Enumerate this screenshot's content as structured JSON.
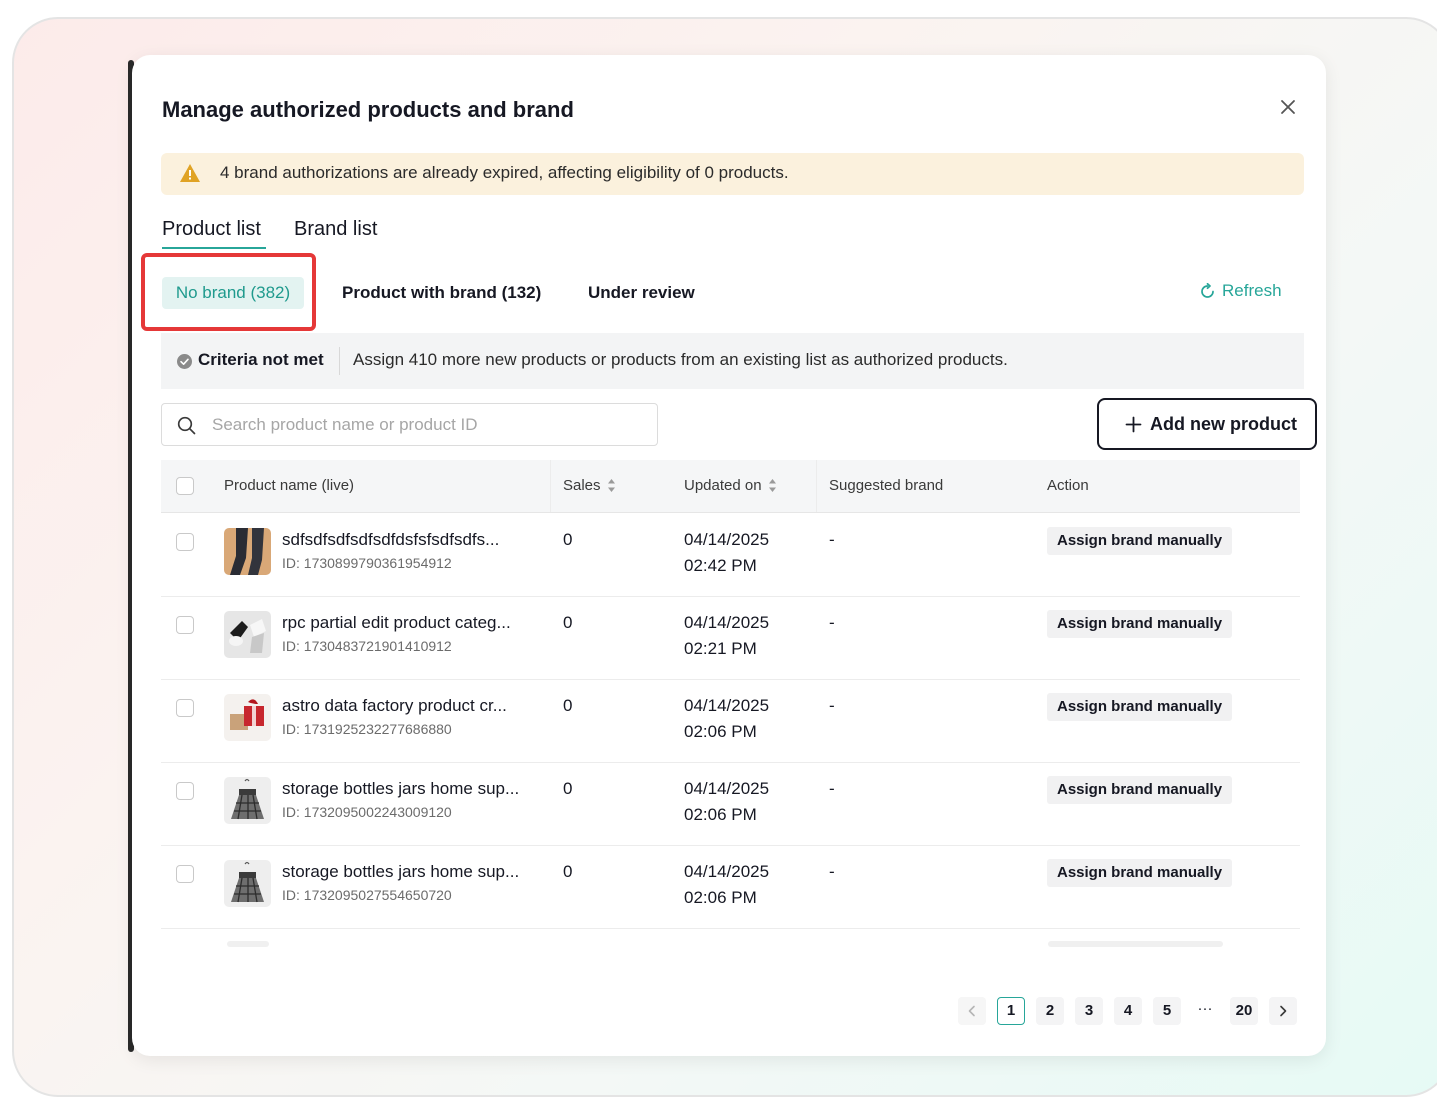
{
  "modal": {
    "title": "Manage authorized products and brand"
  },
  "alert": {
    "message": "4 brand authorizations are already expired, affecting eligibility of 0 products."
  },
  "tabs": [
    {
      "label": "Product list",
      "active": true
    },
    {
      "label": "Brand list",
      "active": false
    }
  ],
  "subtabs": [
    {
      "label": "No brand (382)",
      "active": true
    },
    {
      "label": "Product with brand (132)",
      "active": false
    },
    {
      "label": "Under review",
      "active": false
    }
  ],
  "refresh_label": "Refresh",
  "criteria": {
    "label": "Criteria not met",
    "description": "Assign 410 more new products or products from an existing list as authorized products."
  },
  "search": {
    "placeholder": "Search product name or product ID",
    "value": ""
  },
  "add_button_label": "Add new product",
  "table": {
    "columns": [
      "Product name (live)",
      "Sales",
      "Updated on",
      "Suggested brand",
      "Action"
    ],
    "rows": [
      {
        "name": "sdfsdfsdfsdfsdfdsfsfsdfsdfs...",
        "id": "ID: 1730899790361954912",
        "sales": "0",
        "date": "04/14/2025",
        "time": "02:42 PM",
        "brand": "-",
        "action": "Assign brand manually",
        "thumb": "stockings"
      },
      {
        "name": "rpc partial edit product categ...",
        "id": "ID: 1730483721901410912",
        "sales": "0",
        "date": "04/14/2025",
        "time": "02:21 PM",
        "brand": "-",
        "action": "Assign brand manually",
        "thumb": "socks"
      },
      {
        "name": "astro data factory product cr...",
        "id": "ID: 1731925232277686880",
        "sales": "0",
        "date": "04/14/2025",
        "time": "02:06 PM",
        "brand": "-",
        "action": "Assign brand manually",
        "thumb": "gift"
      },
      {
        "name": "storage bottles jars home sup...",
        "id": "ID: 1732095002243009120",
        "sales": "0",
        "date": "04/14/2025",
        "time": "02:06 PM",
        "brand": "-",
        "action": "Assign brand manually",
        "thumb": "skirt"
      },
      {
        "name": "storage bottles jars home sup...",
        "id": "ID: 1732095027554650720",
        "sales": "0",
        "date": "04/14/2025",
        "time": "02:06 PM",
        "brand": "-",
        "action": "Assign brand manually",
        "thumb": "skirt"
      }
    ]
  },
  "pagination": {
    "pages": [
      "1",
      "2",
      "3",
      "4",
      "5"
    ],
    "ellipsis": "···",
    "last": "20",
    "current": "1"
  },
  "colors": {
    "accent": "#27a699",
    "highlight": "#e53838",
    "alert_bg": "#fbf1dd",
    "warning": "#e0a325"
  }
}
